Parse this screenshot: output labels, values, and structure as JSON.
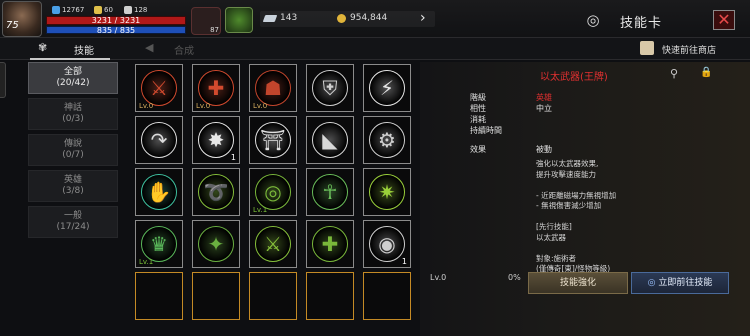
{
  "hud": {
    "player_level": "75",
    "stat1": "12767",
    "stat2": "60",
    "stat3": "128",
    "hp": "3231 / 3231",
    "mp": "835 / 835",
    "bag_count": "87",
    "currency1": "143",
    "currency2": "954,844"
  },
  "header": {
    "title": "技能卡",
    "close_label": "✕"
  },
  "tabs": {
    "skills_label": "技能",
    "combine_label": "合成",
    "shop_label": "快速前往商店"
  },
  "sidebar": [
    {
      "label": "全部",
      "count": "(20/42)"
    },
    {
      "label": "神話",
      "count": "(0/3)"
    },
    {
      "label": "傳說",
      "count": "(0/7)"
    },
    {
      "label": "英雄",
      "count": "(3/8)"
    },
    {
      "label": "一般",
      "count": "(17/24)"
    }
  ],
  "cards": [
    {
      "icon": "sword-swing-icon",
      "color": "#d24a2e",
      "lv": "Lv.0",
      "count": ""
    },
    {
      "icon": "compass-cross-icon",
      "color": "#d24a2e",
      "lv": "Lv.0",
      "count": ""
    },
    {
      "icon": "warrior-silhouette-icon",
      "color": "#c2452c",
      "lv": "Lv.0",
      "count": ""
    },
    {
      "icon": "shield-heart-icon",
      "color": "#cfcfcf",
      "lv": "",
      "count": ""
    },
    {
      "icon": "lightning-icon",
      "color": "#e6e6e6",
      "lv": "",
      "count": ""
    },
    {
      "icon": "curved-arrow-icon",
      "color": "#dcdcdc",
      "lv": "",
      "count": ""
    },
    {
      "icon": "burst-icon",
      "color": "#e8e8e8",
      "lv": "",
      "count": "1"
    },
    {
      "icon": "altar-icon",
      "color": "#e0e0e0",
      "lv": "",
      "count": ""
    },
    {
      "icon": "slashing-eye-icon",
      "color": "#d8d8d8",
      "lv": "",
      "count": ""
    },
    {
      "icon": "gear-skull-icon",
      "color": "#d0d0d0",
      "lv": "",
      "count": ""
    },
    {
      "icon": "hand-blade-icon",
      "color": "#3ec2a0",
      "lv": "",
      "count": ""
    },
    {
      "icon": "spiral-arrow-icon",
      "color": "#86c03a",
      "lv": "",
      "count": ""
    },
    {
      "icon": "whirlwind-icon",
      "color": "#7ab83a",
      "lv": "Lv.1",
      "count": ""
    },
    {
      "icon": "figure-aura-icon",
      "color": "#6abf5a",
      "lv": "",
      "count": ""
    },
    {
      "icon": "star-burst-icon",
      "color": "#9ad03a",
      "lv": "",
      "count": ""
    },
    {
      "icon": "helm-emblem-icon",
      "color": "#5ab85a",
      "lv": "Lv.1",
      "count": ""
    },
    {
      "icon": "dragon-blade-icon",
      "color": "#6ab040",
      "lv": "",
      "count": ""
    },
    {
      "icon": "sword-circle-icon",
      "color": "#86c03a",
      "lv": "",
      "count": ""
    },
    {
      "icon": "cross-circle-icon",
      "color": "#7ab83a",
      "lv": "",
      "count": ""
    },
    {
      "icon": "eye-icon",
      "color": "#cfcfcf",
      "lv": "",
      "count": "1"
    }
  ],
  "detail": {
    "title": "以太武器(王牌)",
    "grade_label": "階級",
    "grade_value": "英雄",
    "attr_label": "相性",
    "attr_value": "中立",
    "cost_label": "消耗",
    "duration_label": "持續時間",
    "effect_label": "效果",
    "effect_value": "被動",
    "desc_lines": [
      "強化以太武器效果,",
      "提升攻擊速度能力",
      "",
      "- 近距離磁場力無視增加",
      "- 無視傷害減少增加",
      "",
      "[先行技能]",
      "以太武器",
      "",
      "對象:施術者",
      "(僅傳奇[東]/怪物等級)"
    ],
    "level": "Lv.0",
    "percent": "0%",
    "upgrade_label": "技能強化",
    "go_label": "立即前往技能"
  }
}
